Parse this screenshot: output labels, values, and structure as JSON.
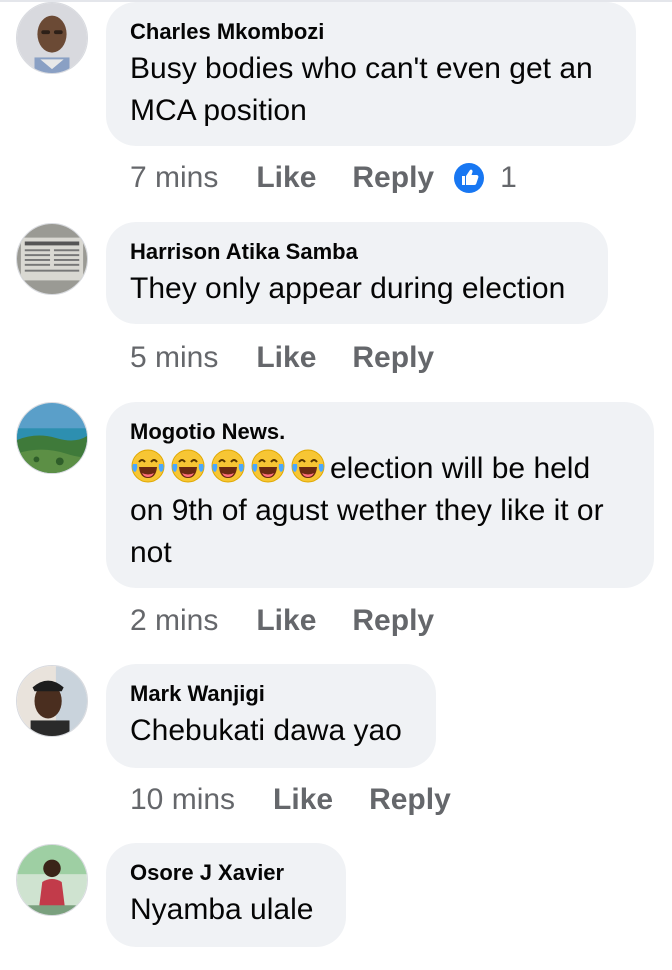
{
  "comments": [
    {
      "author": "Charles Mkombozi",
      "text": "Busy bodies who can't even get an MCA position",
      "time": "7 mins",
      "like_label": "Like",
      "reply_label": "Reply",
      "reaction_count": "1",
      "avatar_icon": "man-portrait-icon"
    },
    {
      "author": "Harrison Atika Samba",
      "text": "They only appear during election",
      "time": "5 mins",
      "like_label": "Like",
      "reply_label": "Reply",
      "avatar_icon": "newspaper-photo-icon"
    },
    {
      "author": "Mogotio News.",
      "text": "election will be held on 9th of agust wether they like it or not",
      "emoji_icon": "laughing-crying-emoji-icon",
      "emoji_count": 5,
      "time": "2 mins",
      "like_label": "Like",
      "reply_label": "Reply",
      "avatar_icon": "landscape-photo-icon"
    },
    {
      "author": "Mark Wanjigi",
      "text": "Chebukati dawa yao",
      "time": "10 mins",
      "like_label": "Like",
      "reply_label": "Reply",
      "avatar_icon": "man-selfie-icon"
    },
    {
      "author": "Osore J Xavier",
      "text": "Nyamba ulale",
      "time": "",
      "like_label": "",
      "reply_label": "",
      "avatar_icon": "person-photo-icon"
    }
  ],
  "colors": {
    "bubble_bg": "#f0f2f5",
    "action_text": "#65676b",
    "like_blue": "#1877f2",
    "emoji_yellow": "#f7c634"
  }
}
